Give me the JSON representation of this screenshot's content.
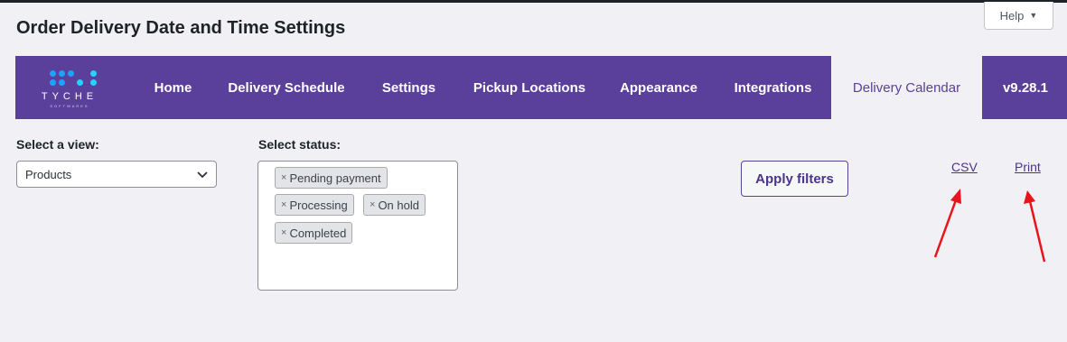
{
  "page": {
    "title": "Order Delivery Date and Time Settings"
  },
  "help": {
    "label": "Help",
    "caret": "▼"
  },
  "logo": {
    "wordmark": "TYCHE",
    "sub": "SOFTWARES",
    "dot_colors": [
      "#1aa3ff",
      "#1aa3ff",
      "#1aa3ff",
      "#23d3ff",
      "#1aa3ff",
      "#23d3ff"
    ]
  },
  "nav": {
    "items": [
      {
        "label": "Home"
      },
      {
        "label": "Delivery Schedule"
      },
      {
        "label": "Settings"
      },
      {
        "label": "Pickup Locations"
      },
      {
        "label": "Appearance"
      },
      {
        "label": "Integrations"
      },
      {
        "label": "Delivery Calendar",
        "active": true
      }
    ],
    "version": "v9.28.1"
  },
  "filters": {
    "view_label": "Select a view:",
    "view_value": "Products",
    "status_label": "Select status:",
    "status_tags": [
      "Pending payment",
      "Processing",
      "On hold",
      "Completed"
    ],
    "remove_glyph": "×",
    "apply_label": "Apply filters"
  },
  "export": {
    "csv_label": "CSV",
    "print_label": "Print"
  },
  "colors": {
    "brand": "#5a3f9b",
    "arrow": "#e8141b"
  }
}
